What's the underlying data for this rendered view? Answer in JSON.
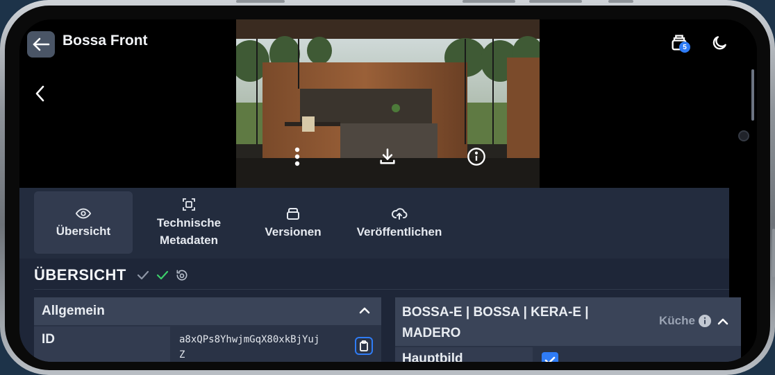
{
  "header": {
    "title": "Bossa Front",
    "back_icon": "arrow-left-icon",
    "cart_badge": "5",
    "theme_icon": "moon-icon"
  },
  "image_actions": {
    "more_icon": "more-vertical-icon",
    "download_icon": "download-icon",
    "info_icon": "info-icon"
  },
  "tabs": [
    {
      "label": "Übersicht",
      "icon": "eye-icon",
      "active": true
    },
    {
      "label": "Technische Metadaten",
      "icon": "scan-icon",
      "active": false
    },
    {
      "label": "Versionen",
      "icon": "layers-icon",
      "active": false
    },
    {
      "label": "Veröffentlichen",
      "icon": "cloud-upload-icon",
      "active": false
    }
  ],
  "section": {
    "title": "ÜBERSICHT"
  },
  "general_card": {
    "title": "Allgemein",
    "rows": [
      {
        "label": "ID",
        "value_line1": "a8xQPs8YhwjmGqX80xkBjYuj",
        "value_line2": "Z"
      }
    ]
  },
  "product_card": {
    "title_line1": "BOSSA-E | BOSSA | KERA-E |",
    "title_line2": "MADERO",
    "category": "Küche",
    "rows": [
      {
        "label": "Hauptbild",
        "checked": true
      }
    ]
  },
  "colors": {
    "accent": "#2f7cf6",
    "check_green": "#3ccf6a",
    "panel": "#1e2638"
  }
}
